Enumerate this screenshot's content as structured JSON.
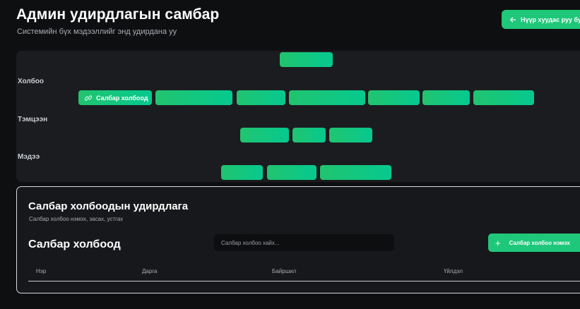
{
  "header": {
    "title": "Админ удирдлагын самбар",
    "subtitle": "Системийн бүх мэдээллийг энд удирдана уу",
    "home_button_label": "Нүүр хуудас руу буцах"
  },
  "nav": {
    "sections": [
      {
        "label": "Холбоо",
        "active_item": "Салбар холбоод"
      },
      {
        "label": "Тэмцээн"
      },
      {
        "label": "Мэдээ"
      }
    ]
  },
  "manage": {
    "title": "Салбар холбоодын удирдлага",
    "subtitle": "Салбар холбоо нэмэх, засах, устгах",
    "list_title": "Салбар холбоод",
    "search_placeholder": "Салбар холбоо хайх...",
    "add_button_label": "Салбар холбоо нэмэх",
    "table_columns": [
      "Нэр",
      "Дарга",
      "Байршил",
      "Үйлдэл"
    ]
  },
  "colors": {
    "accent": "#1fc77a",
    "background": "#0e0f11",
    "panel": "#1b1c1f"
  },
  "icons": {
    "home_button": "arrow-left-icon",
    "active_nav": "link-icon",
    "add_button": "plus-icon"
  }
}
